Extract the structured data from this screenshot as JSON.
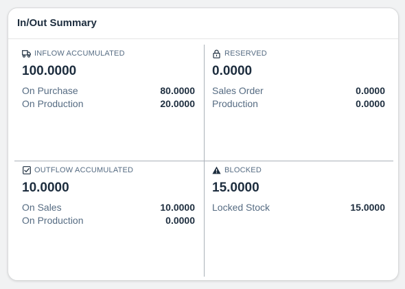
{
  "card": {
    "title": "In/Out Summary"
  },
  "sections": {
    "inflow": {
      "icon": "truck-icon",
      "label": "INFLOW ACCUMULATED",
      "total": "100.0000",
      "rows": [
        {
          "label": "On Purchase",
          "value": "80.0000"
        },
        {
          "label": "On Production",
          "value": "20.0000"
        }
      ]
    },
    "reserved": {
      "icon": "lock-icon",
      "label": "RESERVED",
      "total": "0.0000",
      "rows": [
        {
          "label": "Sales Order",
          "value": "0.0000"
        },
        {
          "label": "Production",
          "value": "0.0000"
        }
      ]
    },
    "outflow": {
      "icon": "checkbox-icon",
      "label": "OUTFLOW ACCUMULATED",
      "total": "10.0000",
      "rows": [
        {
          "label": "On Sales",
          "value": "10.0000"
        },
        {
          "label": "On Production",
          "value": "0.0000"
        }
      ]
    },
    "blocked": {
      "icon": "warning-icon",
      "label": "BLOCKED",
      "total": "15.0000",
      "rows": [
        {
          "label": "Locked Stock",
          "value": "15.0000"
        }
      ]
    }
  },
  "colors": {
    "text_primary": "#1d2d3e",
    "text_secondary": "#556b82",
    "divider": "#a9b0b8"
  }
}
